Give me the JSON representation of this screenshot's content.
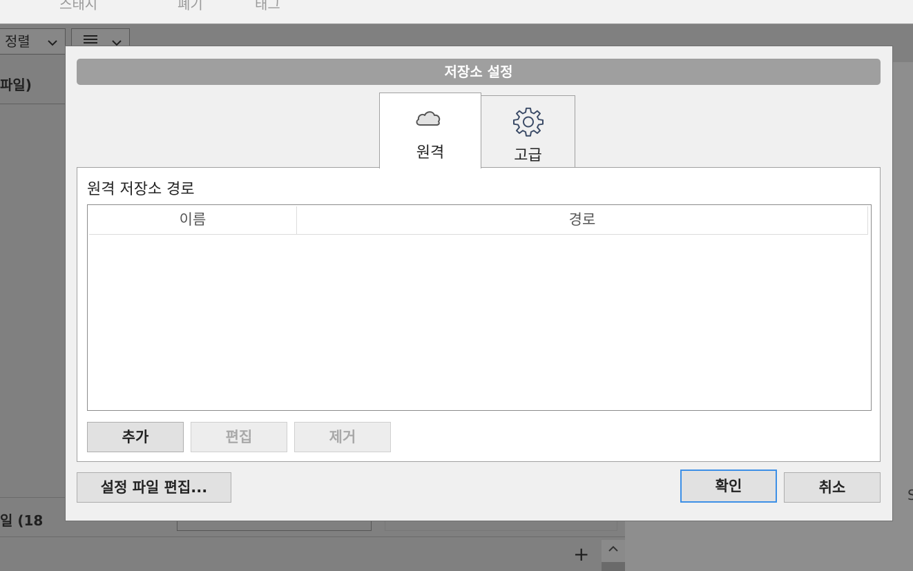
{
  "background": {
    "top_tabs": [
      "스태시",
      "폐기",
      "태그"
    ],
    "sort_label": "정렬",
    "files_heading": "파일)",
    "bottom_label": "일  (18",
    "edge_char": "S"
  },
  "dialog": {
    "title": "저장소 설정",
    "tabs": [
      {
        "label": "원격",
        "icon": "cloud-icon",
        "selected": true
      },
      {
        "label": "고급",
        "icon": "gear-icon",
        "selected": false
      }
    ],
    "remote_panel": {
      "title": "원격 저장소 경로",
      "columns": [
        "이름",
        "경로"
      ],
      "rows": [],
      "buttons": {
        "add": "추가",
        "edit": "편집",
        "remove": "제거"
      }
    },
    "footer": {
      "edit_config": "설정 파일 편집...",
      "ok": "확인",
      "cancel": "취소"
    }
  },
  "colors": {
    "accent": "#3c8fe6",
    "title_bar": "#9f9f9f",
    "overlay": "#808080"
  }
}
